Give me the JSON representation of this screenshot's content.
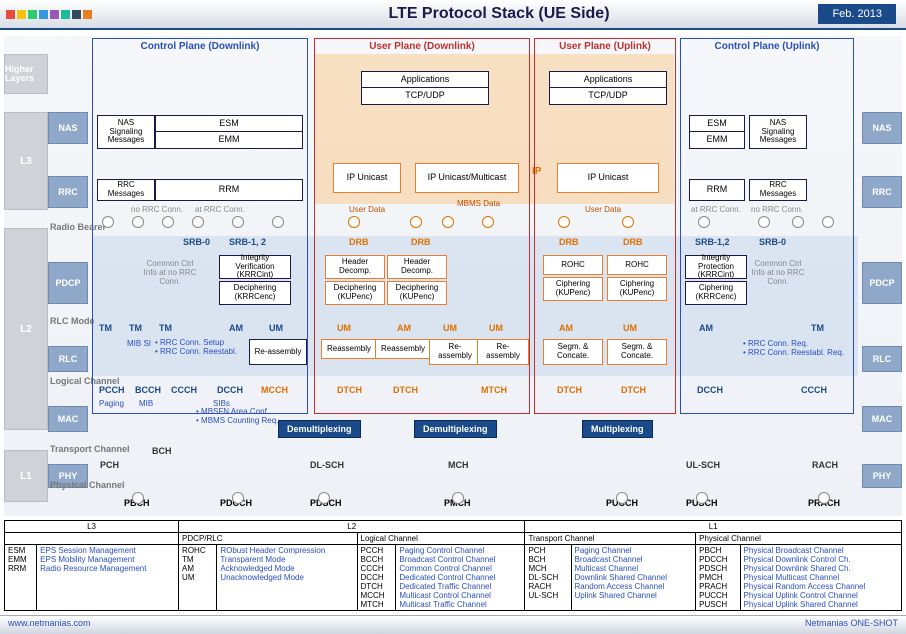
{
  "header": {
    "title": "LTE Protocol Stack (UE Side)",
    "date": "Feb. 2013"
  },
  "layers": {
    "hl": "Higher\nLayers",
    "l3": "L3",
    "l2": "L2",
    "l1": "L1"
  },
  "side": {
    "nas": "NAS",
    "rrc": "RRC",
    "pdcp": "PDCP",
    "rlc": "RLC",
    "mac": "MAC",
    "phy": "PHY"
  },
  "row": {
    "rb": "Radio Bearer",
    "rlcmode": "RLC Mode",
    "logch": "Logical Channel",
    "trch": "Transport Channel",
    "phych": "Physical Channel"
  },
  "plane": {
    "cpd": "Control Plane (Downlink)",
    "upd": "User Plane (Downlink)",
    "upu": "User Plane (Uplink)",
    "cpu": "Control Plane (Uplink)"
  },
  "b": {
    "nasSig": "NAS Signaling Messages",
    "esm": "ESM",
    "emm": "EMM",
    "rrcMsg": "RRC Messages",
    "rrm": "RRM",
    "apps": "Applications",
    "tcp": "TCP/UDP",
    "ipu": "IP Unicast",
    "ipum": "IP Unicast/Multicast",
    "srb0": "SRB-0",
    "srb12": "SRB-1, 2",
    "srb12u": "SRB-1,2",
    "drb": "DRB",
    "iv": "Integrity Verification (KRRCint)",
    "dec": "Deciphering (KRRCenc)",
    "ip": "Integrity Protection (KRRCint)",
    "ciph": "Ciphering (KRRCenc)",
    "hd": "Header Decomp.",
    "decu": "Deciphering (KUPenc)",
    "rohc": "ROHC",
    "ciphu": "Ciphering (KUPenc)",
    "tm": "TM",
    "am": "AM",
    "um": "UM",
    "reasm": "Re-assembly",
    "reasm2": "Reassembly",
    "seg": "Segm. & Concate.",
    "demux": "Demultiplexing",
    "mux": "Multiplexing"
  },
  "ch": {
    "pcch": "PCCH",
    "bcch": "BCCH",
    "ccch": "CCCH",
    "dcch": "DCCH",
    "mcch": "MCCH",
    "dtch": "DTCH",
    "mtch": "MTCH",
    "pch": "PCH",
    "bch": "BCH",
    "dlsch": "DL-SCH",
    "mch": "MCH",
    "ulsch": "UL-SCH",
    "rach": "RACH",
    "pbch": "PBCH",
    "pdcch": "PDCCH",
    "pdsch": "PDSCH",
    "pmch": "PMCH",
    "pucch": "PUCCH",
    "pusch": "PUSCH",
    "prach": "PRACH"
  },
  "notes": {
    "common": "Common Ctrl Info at no RRC Conn.",
    "noRrc": "no RRC Conn.",
    "atRrc": "at RRC Conn.",
    "ud": "User Data",
    "mbms": "MBMS Data",
    "mibsi": "MIB SI",
    "rrcSetup": "• RRC Conn. Setup",
    "rrcReest": "• RRC Conn. Reestabl.",
    "paging": "Paging",
    "mib": "MIB",
    "sibs": "SIBs",
    "mbsfn": "• MBSFN Area Conf.",
    "mbmsCnt": "• MBMS Counting Req.",
    "rrcReq": "• RRC Conn. Req.",
    "rrcReestReq": "• RRC Conn. Reestabl. Req.",
    "ipLbl": "IP"
  },
  "legend": {
    "headers": {
      "l3": "L3",
      "l2": "L2",
      "l1": "L1",
      "pdcprlc": "PDCP/RLC",
      "logch": "Logical Channel",
      "trch": "Transport Channel",
      "phych": "Physical Channel"
    },
    "l3": [
      [
        "ESM",
        "EPS Session Management"
      ],
      [
        "EMM",
        "EPS Mobility Management"
      ],
      [
        "RRM",
        "Radio Resource Management"
      ]
    ],
    "pdcprlc": [
      [
        "ROHC",
        "RObust Header Compression"
      ],
      [
        "TM",
        "Transparent Mode"
      ],
      [
        "AM",
        "Acknowledged Mode"
      ],
      [
        "UM",
        "Unacknowledged Mode"
      ]
    ],
    "logch": [
      [
        "PCCH",
        "Paging Control Channel"
      ],
      [
        "BCCH",
        "Broadcast Control Channel"
      ],
      [
        "CCCH",
        "Common Control Channel"
      ],
      [
        "DCCH",
        "Dedicated Control Channel"
      ],
      [
        "DTCH",
        "Dedicated Traffic Channel"
      ],
      [
        "MCCH",
        "Multicast Control Channel"
      ],
      [
        "MTCH",
        "Multicast Traffic Channel"
      ]
    ],
    "trch": [
      [
        "PCH",
        "Paging Channel"
      ],
      [
        "BCH",
        "Broadcast Channel"
      ],
      [
        "MCH",
        "Multicast Channel"
      ],
      [
        "DL-SCH",
        "Downlink Shared Channel"
      ],
      [
        "RACH",
        "Random Access Channel"
      ],
      [
        "UL-SCH",
        "Uplink Shared Channel"
      ]
    ],
    "phych": [
      [
        "PBCH",
        "Physical Broadcast Channel"
      ],
      [
        "PDCCH",
        "Physical Downlink Control Ch."
      ],
      [
        "PDSCH",
        "Physical Downlink Shared Ch."
      ],
      [
        "PMCH",
        "Physical Multicast Channel"
      ],
      [
        "PRACH",
        "Physical Random Access Channel"
      ],
      [
        "PUCCH",
        "Physical Uplink Control Channel"
      ],
      [
        "PUSCH",
        "Physical Uplink Shared Channel"
      ]
    ]
  },
  "footer": {
    "left": "www.netmanias.com",
    "right": "Netmanias ONE-SHOT"
  }
}
